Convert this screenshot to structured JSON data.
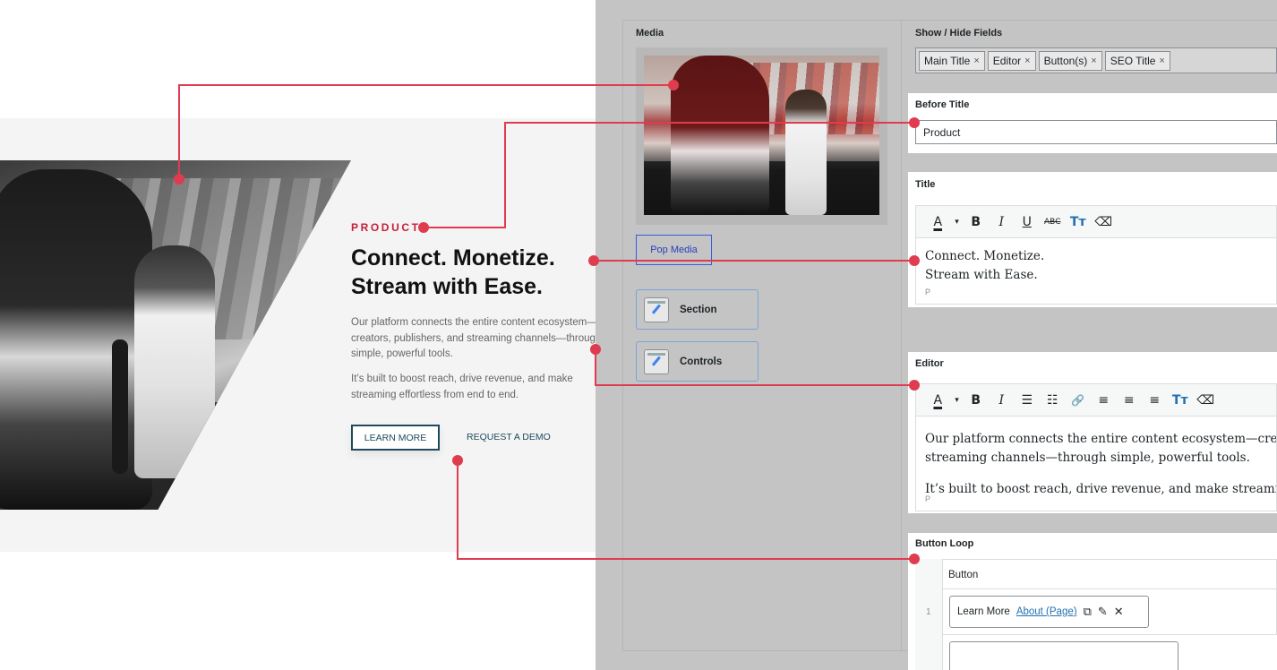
{
  "preview": {
    "eyebrow": "PRODUCT",
    "headline_line1": "Connect. Monetize.",
    "headline_line2": "Stream with Ease.",
    "body1": "Our platform connects the entire content ecosystem—creators, publishers, and streaming channels—through simple, powerful tools.",
    "body2": "It’s built to boost reach, drive revenue, and make streaming effortless from end to end.",
    "button_primary": "LEARN MORE",
    "button_secondary": "REQUEST A DEMO"
  },
  "admin": {
    "media_label": "Media",
    "pop_media_label": "Pop Media",
    "section_label": "Section",
    "controls_label": "Controls",
    "show_hide_label": "Show / Hide Fields",
    "tags": [
      "Main Title",
      "Editor",
      "Button(s)",
      "SEO Title"
    ],
    "tag_remove_symbol": "×",
    "before_title_label": "Before Title",
    "before_title_value": "Product",
    "title_label": "Title",
    "title_line1": "Connect. Monetize.",
    "title_line2": "Stream with Ease.",
    "title_path": "P",
    "editor_label": "Editor",
    "editor_para1_line1": "Our platform connects the entire content ecosystem—creators, p",
    "editor_para1_line2": "streaming channels—through simple, powerful tools.",
    "editor_para2": "It’s built to boost reach, drive revenue, and make streaming effo",
    "editor_path": "P",
    "button_loop_label": "Button Loop",
    "button_column_header": "Button",
    "row_number": "1",
    "button_item_title": "Learn More",
    "button_item_link": "About (Page)"
  },
  "toolbars": {
    "title_tools": [
      "A",
      "▾",
      "B",
      "I",
      "U",
      "ABC",
      "Tт",
      "⌫"
    ],
    "editor_tools": [
      "A",
      "▾",
      "B",
      "I",
      "☰",
      "☷",
      "🔗",
      "≡",
      "≡",
      "≡",
      "Tт",
      "⌫"
    ]
  },
  "colors": {
    "accent_red": "#c4213a",
    "connector_red": "#e03c4f",
    "teal": "#1e4a5c",
    "link_blue": "#2271b1",
    "admin_gray": "#c4c4c4"
  }
}
